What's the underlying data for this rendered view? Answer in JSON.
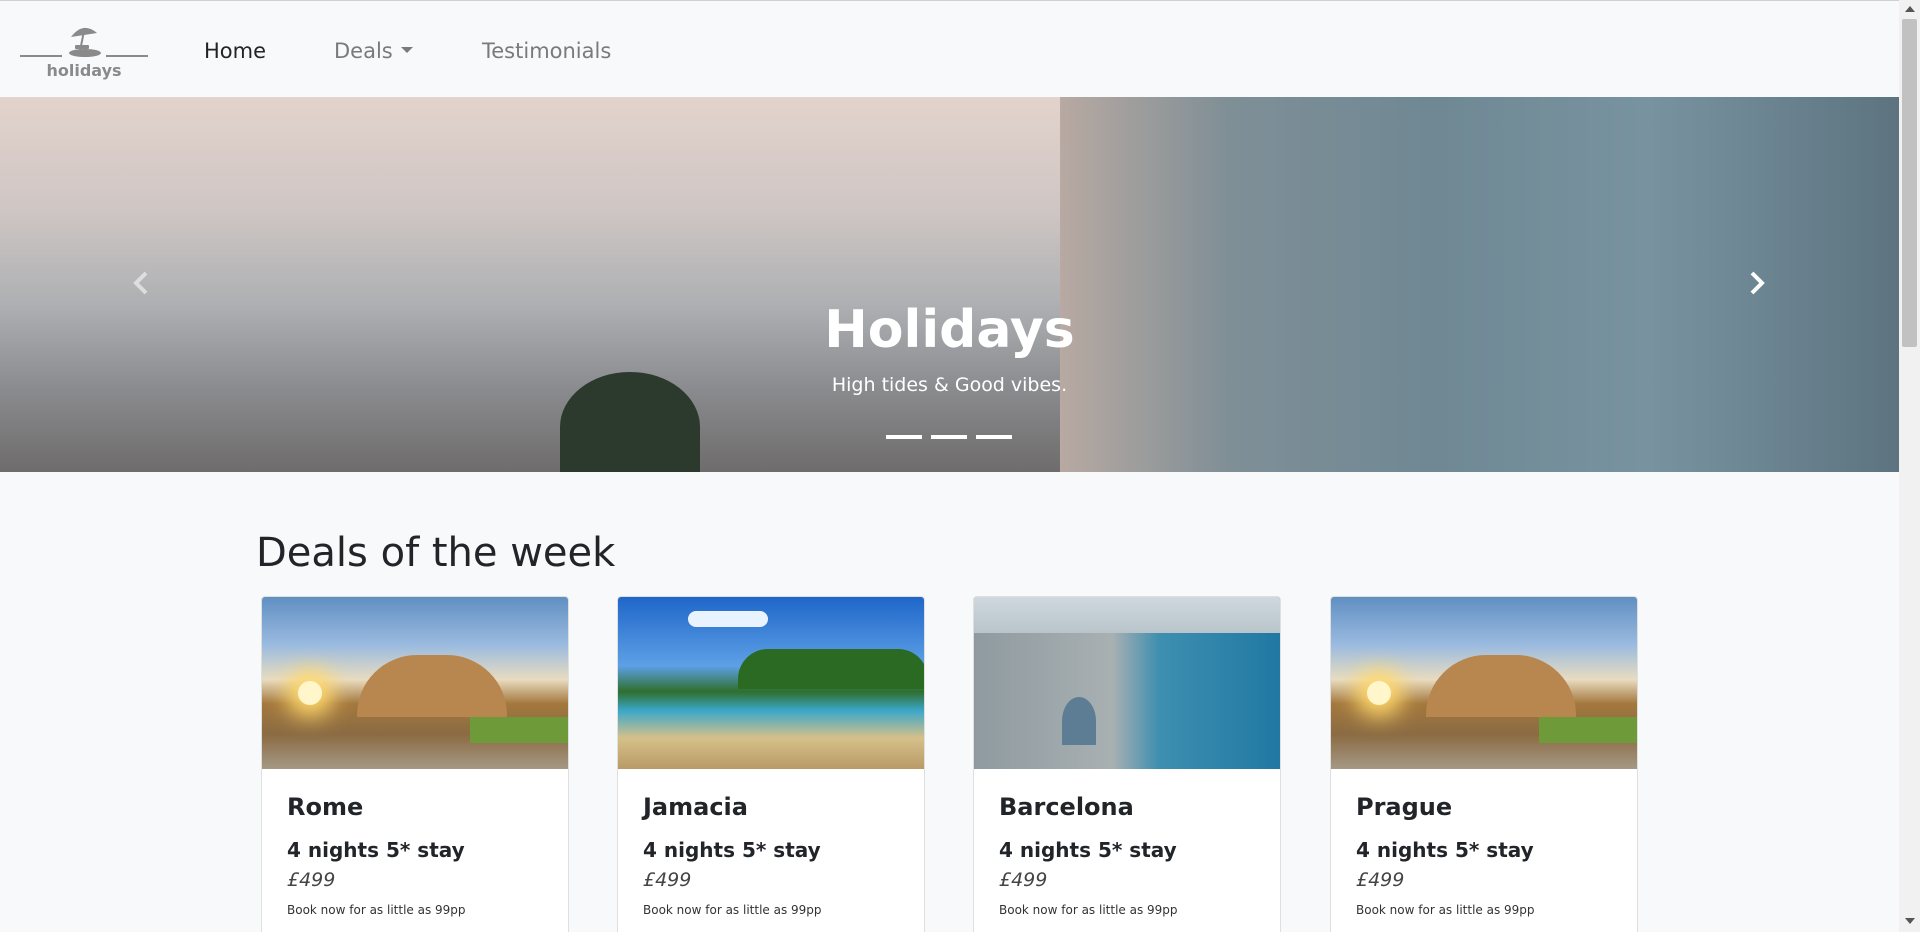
{
  "brand": {
    "logo_text": "holidays",
    "logo_icon": "beach-umbrella-icon"
  },
  "nav": {
    "home_label": "Home",
    "deals_label": "Deals",
    "testimonials_label": "Testimonials"
  },
  "hero": {
    "title": "Holidays",
    "subtitle": "High tides & Good vibes.",
    "prev_icon": "chevron-left-icon",
    "next_icon": "chevron-right-icon",
    "slide_count": 3
  },
  "deals": {
    "heading": "Deals of the week",
    "items": [
      {
        "title": "Rome",
        "stay": "4 nights 5* stay",
        "price": "£499",
        "note": "Book now for as little as 99pp",
        "image": "colosseum-image"
      },
      {
        "title": "Jamacia",
        "stay": "4 nights 5* stay",
        "price": "£499",
        "note": "Book now for as little as 99pp",
        "image": "beach-image"
      },
      {
        "title": "Barcelona",
        "stay": "4 nights 5* stay",
        "price": "£499",
        "note": "Book now for as little as 99pp",
        "image": "barcelona-coast-image"
      },
      {
        "title": "Prague",
        "stay": "4 nights 5* stay",
        "price": "£499",
        "note": "Book now for as little as 99pp",
        "image": "colosseum-image"
      }
    ]
  },
  "colors": {
    "page_bg": "#f8f9fa",
    "nav_active": "#212529",
    "nav_inactive": "#7a7a7a",
    "card_border": "#dfdfdf"
  }
}
